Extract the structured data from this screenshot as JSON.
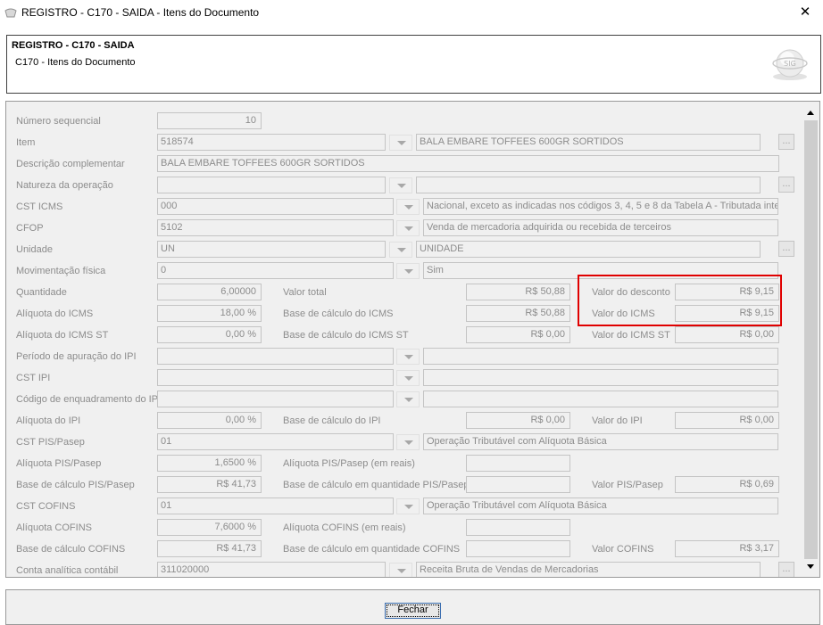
{
  "window": {
    "title": "REGISTRO - C170 - SAIDA - Itens do Documento",
    "close_label": "✕"
  },
  "header": {
    "title": "REGISTRO - C170 - SAIDA",
    "subtitle": "C170 - Itens do Documento",
    "logo_text": "SIG"
  },
  "form": {
    "numero_sequencial": {
      "label": "Número sequencial",
      "value": "10"
    },
    "item": {
      "label": "Item",
      "code": "518574",
      "description": "BALA EMBARE TOFFEES 600GR SORTIDOS"
    },
    "descricao_complementar": {
      "label": "Descrição complementar",
      "value": "BALA EMBARE TOFFEES 600GR SORTIDOS"
    },
    "natureza_operacao": {
      "label": "Natureza da operação",
      "code": "",
      "description": ""
    },
    "cst_icms": {
      "label": "CST ICMS",
      "code": "000",
      "description": "Nacional, exceto as indicadas nos códigos 3, 4, 5 e 8 da Tabela A - Tributada inte"
    },
    "cfop": {
      "label": "CFOP",
      "code": "5102",
      "description": "Venda de mercadoria adquirida ou recebida de terceiros"
    },
    "unidade": {
      "label": "Unidade",
      "code": "UN",
      "description": "UNIDADE"
    },
    "movimentacao_fisica": {
      "label": "Movimentação física",
      "code": "0",
      "description": "Sim"
    },
    "quantidade": {
      "label": "Quantidade",
      "value": "6,00000"
    },
    "valor_total": {
      "label": "Valor total",
      "value": "R$ 50,88"
    },
    "valor_desconto": {
      "label": "Valor do desconto",
      "value": "R$ 9,15"
    },
    "aliquota_icms": {
      "label": "Alíquota do ICMS",
      "value": "18,00 %"
    },
    "base_calculo_icms": {
      "label": "Base de cálculo do ICMS",
      "value": "R$ 50,88"
    },
    "valor_icms": {
      "label": "Valor do ICMS",
      "value": "R$ 9,15"
    },
    "aliquota_icms_st": {
      "label": "Alíquota do ICMS ST",
      "value": "0,00 %"
    },
    "base_calculo_icms_st": {
      "label": "Base de cálculo do ICMS ST",
      "value": "R$ 0,00"
    },
    "valor_icms_st": {
      "label": "Valor do ICMS ST",
      "value": "R$ 0,00"
    },
    "periodo_apuracao_ipi": {
      "label": "Período de apuração do IPI",
      "code": "",
      "description": ""
    },
    "cst_ipi": {
      "label": "CST IPI",
      "code": "",
      "description": ""
    },
    "codigo_enquadramento_ipi": {
      "label": "Código de enquadramento do IPI",
      "code": "",
      "description": ""
    },
    "aliquota_ipi": {
      "label": "Alíquota do IPI",
      "value": "0,00 %"
    },
    "base_calculo_ipi": {
      "label": "Base de cálculo do IPI",
      "value": "R$ 0,00"
    },
    "valor_ipi": {
      "label": "Valor do IPI",
      "value": "R$ 0,00"
    },
    "cst_pis": {
      "label": "CST PIS/Pasep",
      "code": "01",
      "description": "Operação Tributável com Alíquota Básica"
    },
    "aliquota_pis": {
      "label": "Alíquota PIS/Pasep",
      "value": "1,6500 %"
    },
    "aliquota_pis_reais": {
      "label": "Alíquota PIS/Pasep (em reais)",
      "value": ""
    },
    "base_calculo_pis": {
      "label": "Base de cálculo PIS/Pasep",
      "value": "R$ 41,73"
    },
    "base_calculo_qtd_pis": {
      "label": "Base de cálculo em quantidade PIS/Pasep",
      "value": ""
    },
    "valor_pis": {
      "label": "Valor PIS/Pasep",
      "value": "R$ 0,69"
    },
    "cst_cofins": {
      "label": "CST COFINS",
      "code": "01",
      "description": "Operação Tributável com Alíquota Básica"
    },
    "aliquota_cofins": {
      "label": "Alíquota COFINS",
      "value": "7,6000 %"
    },
    "aliquota_cofins_reais": {
      "label": "Alíquota COFINS (em reais)",
      "value": ""
    },
    "base_calculo_cofins": {
      "label": "Base de cálculo COFINS",
      "value": "R$ 41,73"
    },
    "base_calculo_qtd_cofins": {
      "label": "Base de cálculo em quantidade COFINS",
      "value": ""
    },
    "valor_cofins": {
      "label": "Valor COFINS",
      "value": "R$ 3,17"
    },
    "conta_analitica": {
      "label": "Conta analítica contábil",
      "code": "311020000",
      "description": "Receita Bruta de Vendas de Mercadorias"
    },
    "ellipsis_label": "..."
  },
  "footer": {
    "close_button": "Fechar"
  },
  "colors": {
    "highlight": "#e00000",
    "panel_bg": "#f0f0f0",
    "label": "#8c8c8c"
  }
}
